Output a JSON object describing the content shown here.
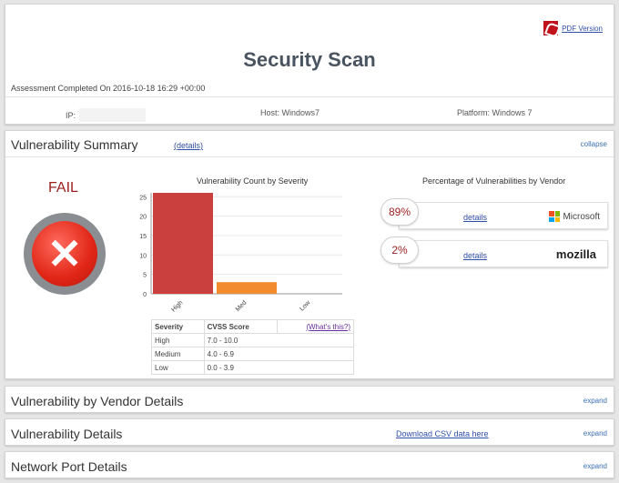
{
  "header": {
    "pdf_label": "PDF Version",
    "title": "Security Scan",
    "assessment": "Assessment Completed On 2016-10-18 16:29 +00:00",
    "ip_label": "IP:",
    "host": "Host: Windows7",
    "platform": "Platform: Windows 7"
  },
  "summary": {
    "title": "Vulnerability Summary",
    "details_link": "(details)",
    "collapse_label": "collapse",
    "status": "FAIL",
    "chart_title": "Vulnerability Count by Severity",
    "table": {
      "headers": [
        "Severity",
        "CVSS Score",
        "(What's this?)"
      ],
      "rows": [
        [
          "High",
          "7.0 - 10.0"
        ],
        [
          "Medium",
          "4.0 - 6.9"
        ],
        [
          "Low",
          "0.0 - 3.9"
        ]
      ]
    },
    "vendor_title": "Percentage of Vulnerabilities by Vendor",
    "vendors": [
      {
        "percent": "89%",
        "details": "details",
        "name": "Microsoft"
      },
      {
        "percent": "2%",
        "details": "details",
        "name": "mozilla"
      }
    ]
  },
  "chart_data": {
    "type": "bar",
    "title": "Vulnerability Count by Severity",
    "categories": [
      "High",
      "Med",
      "Low"
    ],
    "values": [
      26,
      3,
      0
    ],
    "colors": [
      "#c9403e",
      "#f28b2e",
      "#cccccc"
    ],
    "ylim": [
      0,
      26
    ],
    "yticks": [
      0,
      5,
      10,
      15,
      20,
      25
    ],
    "grid": true
  },
  "sections": {
    "vendor_details": {
      "title": "Vulnerability by Vendor Details",
      "action": "expand"
    },
    "vuln_details": {
      "title": "Vulnerability Details",
      "csv_link": "Download CSV data here",
      "action": "expand"
    },
    "port_details": {
      "title": "Network Port Details",
      "action": "expand"
    }
  },
  "colors": {
    "fail_text": "#9b1f1f",
    "title": "#4a5460",
    "link": "#2f4fa8"
  }
}
